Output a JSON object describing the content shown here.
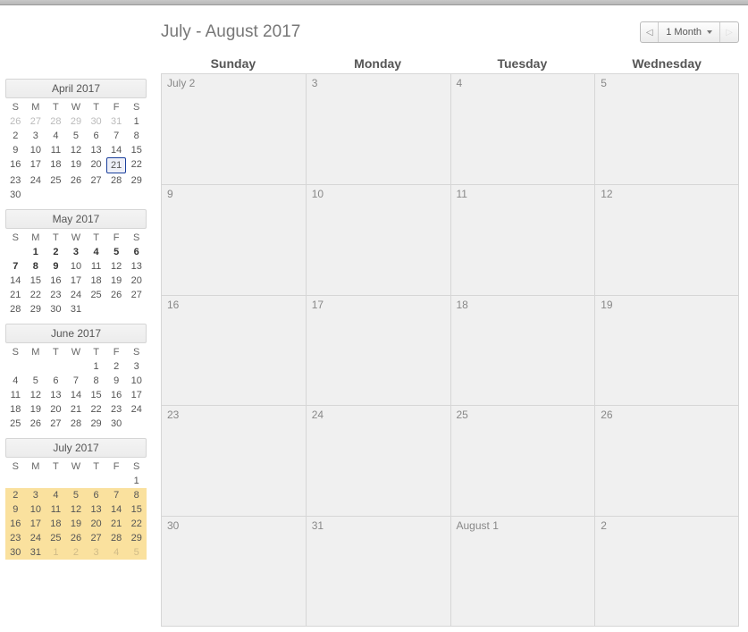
{
  "title": "July - August 2017",
  "nav": {
    "prev_glyph": "◁",
    "range_label": "1 Month",
    "next_glyph": "▷"
  },
  "main_headers": [
    "Sunday",
    "Monday",
    "Tuesday",
    "Wednesday"
  ],
  "main_grid": [
    [
      {
        "label": "July 2"
      },
      {
        "label": "3"
      },
      {
        "label": "4"
      },
      {
        "label": "5"
      }
    ],
    [
      {
        "label": "9"
      },
      {
        "label": "10"
      },
      {
        "label": "11"
      },
      {
        "label": "12"
      }
    ],
    [
      {
        "label": "16"
      },
      {
        "label": "17"
      },
      {
        "label": "18"
      },
      {
        "label": "19"
      }
    ],
    [
      {
        "label": "23"
      },
      {
        "label": "24"
      },
      {
        "label": "25"
      },
      {
        "label": "26"
      }
    ],
    [
      {
        "label": "30"
      },
      {
        "label": "31"
      },
      {
        "label": "August 1"
      },
      {
        "label": "2"
      }
    ]
  ],
  "mini_day_headers": [
    "S",
    "M",
    "T",
    "W",
    "T",
    "F",
    "S"
  ],
  "mini_calendars": [
    {
      "title": "April 2017",
      "days": [
        {
          "n": "26",
          "dim": true
        },
        {
          "n": "27",
          "dim": true
        },
        {
          "n": "28",
          "dim": true
        },
        {
          "n": "29",
          "dim": true
        },
        {
          "n": "30",
          "dim": true
        },
        {
          "n": "31",
          "dim": true
        },
        {
          "n": "1"
        },
        {
          "n": "2"
        },
        {
          "n": "3"
        },
        {
          "n": "4"
        },
        {
          "n": "5"
        },
        {
          "n": "6"
        },
        {
          "n": "7"
        },
        {
          "n": "8"
        },
        {
          "n": "9"
        },
        {
          "n": "10"
        },
        {
          "n": "11"
        },
        {
          "n": "12"
        },
        {
          "n": "13"
        },
        {
          "n": "14"
        },
        {
          "n": "15"
        },
        {
          "n": "16"
        },
        {
          "n": "17"
        },
        {
          "n": "18"
        },
        {
          "n": "19"
        },
        {
          "n": "20"
        },
        {
          "n": "21",
          "boxed": true
        },
        {
          "n": "22"
        },
        {
          "n": "23"
        },
        {
          "n": "24"
        },
        {
          "n": "25"
        },
        {
          "n": "26"
        },
        {
          "n": "27"
        },
        {
          "n": "28"
        },
        {
          "n": "29"
        },
        {
          "n": "30"
        },
        {
          "n": ""
        },
        {
          "n": ""
        },
        {
          "n": ""
        },
        {
          "n": ""
        },
        {
          "n": ""
        },
        {
          "n": ""
        }
      ]
    },
    {
      "title": "May 2017",
      "days": [
        {
          "n": ""
        },
        {
          "n": "1",
          "bold": true
        },
        {
          "n": "2",
          "bold": true
        },
        {
          "n": "3",
          "bold": true
        },
        {
          "n": "4",
          "bold": true
        },
        {
          "n": "5",
          "bold": true
        },
        {
          "n": "6",
          "bold": true
        },
        {
          "n": "7",
          "bold": true
        },
        {
          "n": "8",
          "bold": true
        },
        {
          "n": "9",
          "bold": true
        },
        {
          "n": "10"
        },
        {
          "n": "11"
        },
        {
          "n": "12"
        },
        {
          "n": "13"
        },
        {
          "n": "14"
        },
        {
          "n": "15"
        },
        {
          "n": "16"
        },
        {
          "n": "17"
        },
        {
          "n": "18"
        },
        {
          "n": "19"
        },
        {
          "n": "20"
        },
        {
          "n": "21"
        },
        {
          "n": "22"
        },
        {
          "n": "23"
        },
        {
          "n": "24"
        },
        {
          "n": "25"
        },
        {
          "n": "26"
        },
        {
          "n": "27"
        },
        {
          "n": "28"
        },
        {
          "n": "29"
        },
        {
          "n": "30"
        },
        {
          "n": "31"
        },
        {
          "n": ""
        },
        {
          "n": ""
        },
        {
          "n": ""
        }
      ]
    },
    {
      "title": "June 2017",
      "days": [
        {
          "n": ""
        },
        {
          "n": ""
        },
        {
          "n": ""
        },
        {
          "n": ""
        },
        {
          "n": "1"
        },
        {
          "n": "2"
        },
        {
          "n": "3"
        },
        {
          "n": "4"
        },
        {
          "n": "5"
        },
        {
          "n": "6"
        },
        {
          "n": "7"
        },
        {
          "n": "8"
        },
        {
          "n": "9"
        },
        {
          "n": "10"
        },
        {
          "n": "11"
        },
        {
          "n": "12"
        },
        {
          "n": "13"
        },
        {
          "n": "14"
        },
        {
          "n": "15"
        },
        {
          "n": "16"
        },
        {
          "n": "17"
        },
        {
          "n": "18"
        },
        {
          "n": "19"
        },
        {
          "n": "20"
        },
        {
          "n": "21"
        },
        {
          "n": "22"
        },
        {
          "n": "23"
        },
        {
          "n": "24"
        },
        {
          "n": "25"
        },
        {
          "n": "26"
        },
        {
          "n": "27"
        },
        {
          "n": "28"
        },
        {
          "n": "29"
        },
        {
          "n": "30"
        },
        {
          "n": ""
        }
      ]
    },
    {
      "title": "July 2017",
      "days": [
        {
          "n": ""
        },
        {
          "n": ""
        },
        {
          "n": ""
        },
        {
          "n": ""
        },
        {
          "n": ""
        },
        {
          "n": ""
        },
        {
          "n": "1"
        },
        {
          "n": "2",
          "hl": true
        },
        {
          "n": "3",
          "hl": true
        },
        {
          "n": "4",
          "hl": true
        },
        {
          "n": "5",
          "hl": true
        },
        {
          "n": "6",
          "hl": true
        },
        {
          "n": "7",
          "hl": true
        },
        {
          "n": "8",
          "hl": true
        },
        {
          "n": "9",
          "hl": true
        },
        {
          "n": "10",
          "hl": true
        },
        {
          "n": "11",
          "hl": true
        },
        {
          "n": "12",
          "hl": true
        },
        {
          "n": "13",
          "hl": true
        },
        {
          "n": "14",
          "hl": true
        },
        {
          "n": "15",
          "hl": true
        },
        {
          "n": "16",
          "hl": true
        },
        {
          "n": "17",
          "hl": true
        },
        {
          "n": "18",
          "hl": true
        },
        {
          "n": "19",
          "hl": true
        },
        {
          "n": "20",
          "hl": true
        },
        {
          "n": "21",
          "hl": true
        },
        {
          "n": "22",
          "hl": true
        },
        {
          "n": "23",
          "hl": true
        },
        {
          "n": "24",
          "hl": true
        },
        {
          "n": "25",
          "hl": true
        },
        {
          "n": "26",
          "hl": true
        },
        {
          "n": "27",
          "hl": true
        },
        {
          "n": "28",
          "hl": true
        },
        {
          "n": "29",
          "hl": true
        },
        {
          "n": "30",
          "hl": true
        },
        {
          "n": "31",
          "hl": true
        },
        {
          "n": "1",
          "hl": true,
          "dim": true
        },
        {
          "n": "2",
          "hl": true,
          "dim": true
        },
        {
          "n": "3",
          "hl": true,
          "dim": true
        },
        {
          "n": "4",
          "hl": true,
          "dim": true
        },
        {
          "n": "5",
          "hl": true,
          "dim": true
        }
      ]
    }
  ]
}
